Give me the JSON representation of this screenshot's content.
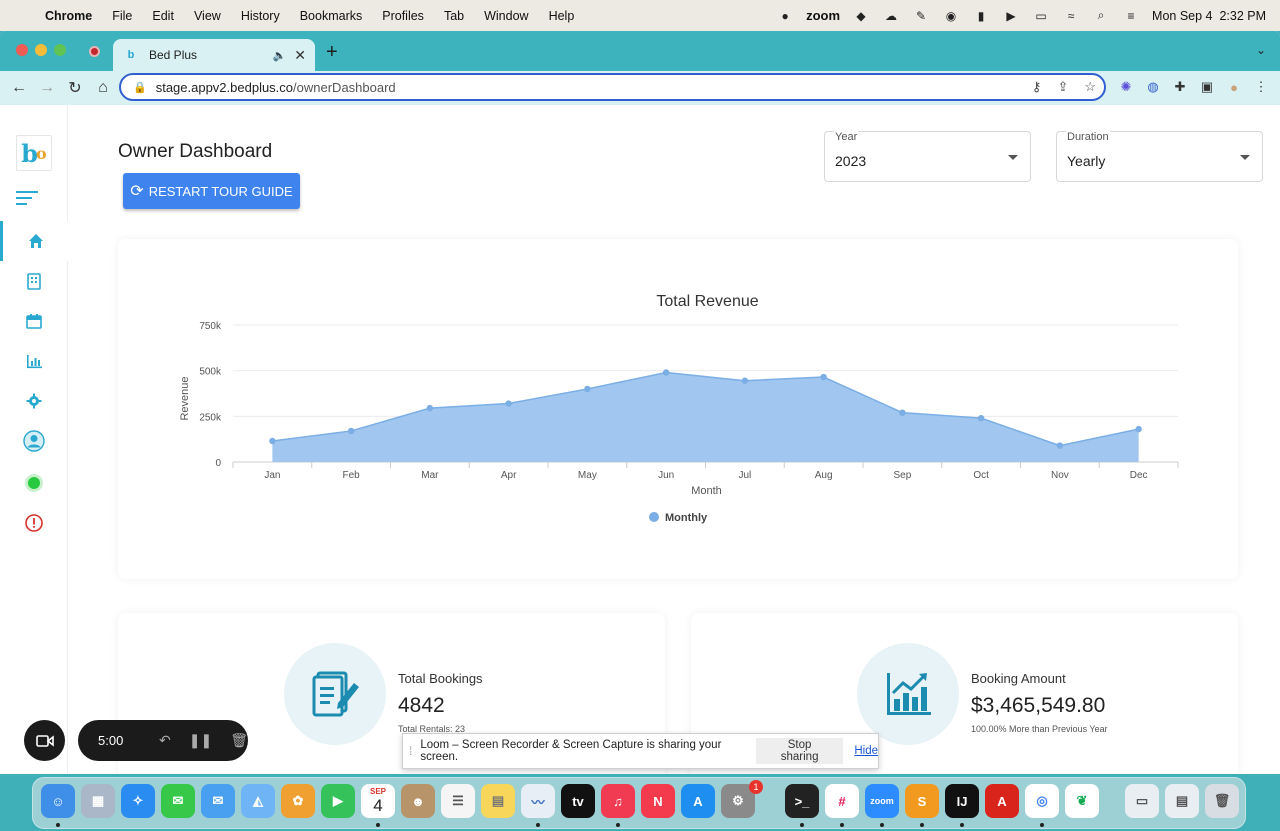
{
  "menubar": {
    "app": "Chrome",
    "items": [
      "File",
      "Edit",
      "View",
      "History",
      "Bookmarks",
      "Profiles",
      "Tab",
      "Window",
      "Help"
    ],
    "zoom": "zoom",
    "datetime": "Mon Sep 4  2:32 PM"
  },
  "browser": {
    "tab_title": "Bed Plus",
    "url_host": "stage.appv2.bedplus.co",
    "url_path": "/ownerDashboard"
  },
  "dashboard": {
    "title": "Owner Dashboard",
    "restart_label": "RESTART TOUR GUIDE",
    "year": {
      "label": "Year",
      "value": "2023"
    },
    "duration": {
      "label": "Duration",
      "value": "Yearly"
    },
    "stats": [
      {
        "label": "Total Bookings",
        "value": "4842",
        "sub": "Total Rentals: 23"
      },
      {
        "label": "Booking Amount",
        "value": "$3,465,549.80",
        "sub": "100.00% More than Previous Year"
      }
    ]
  },
  "chart_data": {
    "type": "area",
    "title": "Total Revenue",
    "xlabel": "Month",
    "ylabel": "Revenue",
    "categories": [
      "Jan",
      "Feb",
      "Mar",
      "Apr",
      "May",
      "Jun",
      "Jul",
      "Aug",
      "Sep",
      "Oct",
      "Nov",
      "Dec"
    ],
    "series": [
      {
        "name": "Monthly",
        "values": [
          115000,
          170000,
          295000,
          320000,
          400000,
          490000,
          445000,
          465000,
          270000,
          240000,
          90000,
          180000
        ]
      }
    ],
    "yticks": [
      "0",
      "250k",
      "500k",
      "750k"
    ],
    "ylim": [
      0,
      750000
    ],
    "grid": true,
    "legend": "bottom-center",
    "color": "#9cc3ee",
    "point_color": "#7aaee4"
  },
  "loom": {
    "timer": "5:00",
    "share_message": "Loom – Screen Recorder & Screen Capture is sharing your screen.",
    "stop_label": "Stop sharing",
    "hide_label": "Hide"
  },
  "dock": {
    "calendar_month": "SEP",
    "calendar_day": "4",
    "appstore_badge": "1"
  },
  "colors": {
    "accent": "#2aa9d0",
    "button": "#3f84ee",
    "desktop": "#3fb0b8"
  }
}
